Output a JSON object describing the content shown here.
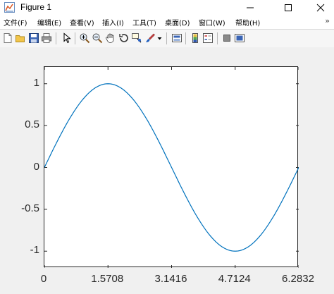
{
  "window": {
    "title": "Figure 1",
    "minimize_glyph": "—",
    "maximize_glyph": "□",
    "close_glyph": "✕",
    "icon": "matlab-figure-icon"
  },
  "menu": {
    "items": [
      {
        "label": "文件(F)"
      },
      {
        "label": "编辑(E)"
      },
      {
        "label": "查看(V)"
      },
      {
        "label": "插入(I)"
      },
      {
        "label": "工具(T)"
      },
      {
        "label": "桌面(D)"
      },
      {
        "label": "窗口(W)"
      },
      {
        "label": "帮助(H)"
      }
    ],
    "overflow_glyph": "»"
  },
  "toolbar": {
    "buttons": [
      "new-figure-icon",
      "open-file-icon",
      "save-icon",
      "print-icon",
      "pointer-icon",
      "zoom-in-icon",
      "zoom-out-icon",
      "pan-hand-icon",
      "rotate-3d-icon",
      "data-cursor-icon",
      "brush-icon",
      "dropdown-arrow-icon",
      "link-plot-icon",
      "colorbar-icon",
      "legend-icon",
      "hide-plot-tools-icon",
      "show-plot-tools-icon"
    ]
  },
  "colors": {
    "line": "#0072bd",
    "axis": "#262626",
    "figure_bg": "#f0f0f0"
  },
  "chart_data": {
    "type": "line",
    "title": "",
    "xlabel": "",
    "ylabel": "",
    "xlim": [
      0,
      6.2832
    ],
    "ylim": [
      -1.2,
      1.2
    ],
    "xticks": [
      0,
      1.5708,
      3.1416,
      4.7124,
      6.2832
    ],
    "xtick_labels": [
      "0",
      "1.5708",
      "3.1416",
      "4.7124",
      "6.2832"
    ],
    "yticks": [
      -1,
      -0.5,
      0,
      0.5,
      1
    ],
    "ytick_labels": [
      "-1",
      "-0.5",
      "0",
      "0.5",
      "1"
    ],
    "grid": false,
    "series": [
      {
        "color": "#0072bd",
        "x": [
          0,
          0.3142,
          0.6283,
          0.9425,
          1.2566,
          1.5708,
          1.885,
          2.1991,
          2.5133,
          2.8274,
          3.1416,
          3.4558,
          3.7699,
          4.0841,
          4.3982,
          4.7124,
          5.0265,
          5.3407,
          5.6549,
          5.969,
          6.2832
        ],
        "y": [
          0,
          0.309,
          0.5878,
          0.809,
          0.9511,
          1,
          0.9511,
          0.809,
          0.5878,
          0.309,
          0,
          -0.309,
          -0.5878,
          -0.809,
          -0.9511,
          -1,
          -0.9511,
          -0.809,
          -0.5878,
          -0.309,
          0
        ]
      }
    ]
  }
}
